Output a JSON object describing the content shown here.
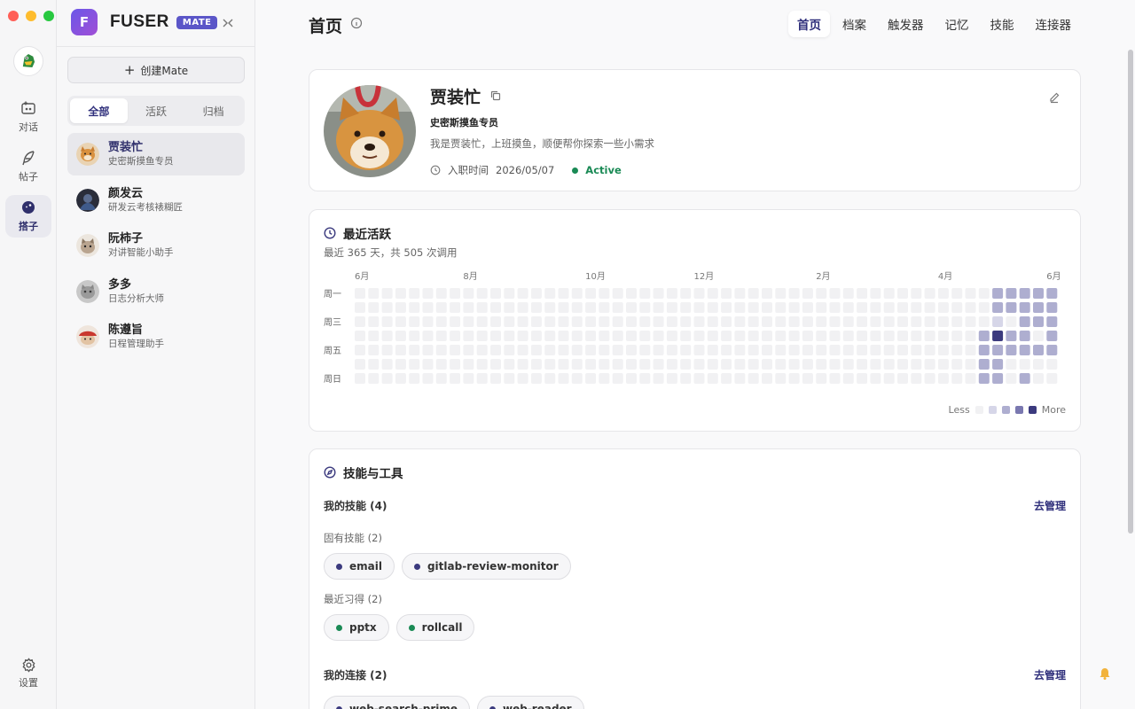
{
  "app": {
    "name": "FUSER",
    "badge": "MATE"
  },
  "rail": {
    "items": [
      {
        "label": "对话",
        "icon": "chat-add-icon"
      },
      {
        "label": "帖子",
        "icon": "feather-icon"
      },
      {
        "label": "搭子",
        "icon": "planet-icon",
        "active": true
      }
    ],
    "settings_label": "设置"
  },
  "sidebar": {
    "create_label": "创建Mate",
    "filters": [
      "全部",
      "活跃",
      "归档"
    ],
    "mates": [
      {
        "name": "贾装忙",
        "desc": "史密斯摸鱼专员",
        "active": true
      },
      {
        "name": "颜发云",
        "desc": "研发云考核裱糊匠"
      },
      {
        "name": "阮柿子",
        "desc": "对讲智能小助手"
      },
      {
        "name": "多多",
        "desc": "日志分析大师"
      },
      {
        "name": "陈遵旨",
        "desc": "日程管理助手"
      }
    ]
  },
  "header": {
    "title": "首页",
    "tabs": [
      "首页",
      "档案",
      "触发器",
      "记忆",
      "技能",
      "连接器"
    ]
  },
  "profile": {
    "name": "贾装忙",
    "title": "史密斯摸鱼专员",
    "bio": "我是贾装忙，上班摸鱼，顺便帮你探索一些小需求",
    "joined_label": "入职时间",
    "joined_date": "2026/05/07",
    "status": "Active",
    "status_color": "#1a8a55"
  },
  "activity": {
    "title": "最近活跃",
    "subtitle": "最近 365 天，共 505 次调用",
    "months": [
      "6月",
      "8月",
      "10月",
      "12月",
      "2月",
      "4月",
      "6月"
    ],
    "weekdays": [
      "周一",
      "",
      "周三",
      "",
      "周五",
      "",
      "周日"
    ],
    "legend_less": "Less",
    "legend_more": "More",
    "levels": [
      "#f1f1f3",
      "#d6d6e8",
      "#aeaed0",
      "#7a78b0",
      "#3b3a7e"
    ],
    "grid": {
      "week46": [
        0,
        0,
        0,
        2,
        2,
        2,
        2
      ],
      "week47": [
        2,
        2,
        1,
        4,
        2,
        2,
        2
      ],
      "week48": [
        2,
        2,
        0,
        2,
        2,
        0,
        0
      ],
      "week49": [
        2,
        2,
        2,
        2,
        2,
        0,
        2
      ],
      "week50": [
        2,
        2,
        2,
        0,
        2,
        0,
        0
      ],
      "week51": [
        2,
        2,
        2,
        2,
        2,
        0,
        0
      ]
    }
  },
  "skills": {
    "title": "技能与工具",
    "my_skills": "我的技能 (4)",
    "manage": "去管理",
    "builtin_label": "固有技能 (2)",
    "builtin": [
      "email",
      "gitlab-review-monitor"
    ],
    "builtin_color": "#3b3a7e",
    "learned_label": "最近习得 (2)",
    "learned": [
      "pptx",
      "rollcall"
    ],
    "learned_color": "#1a8a55",
    "connections": "我的连接 (2)",
    "connections_manage": "去管理",
    "connection_items": [
      "web-search-prime",
      "web-reader"
    ]
  }
}
